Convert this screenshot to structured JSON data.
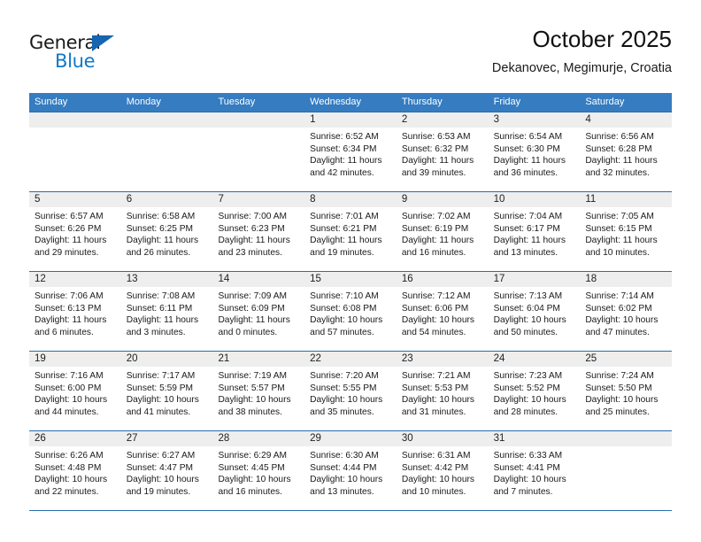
{
  "brand": {
    "name_top": "General",
    "name_bottom": "Blue",
    "triangle_color": "#1565b0",
    "blue_color": "#1279c6"
  },
  "header": {
    "title": "October 2025",
    "subtitle": "Dekanovec, Megimurje, Croatia"
  },
  "theme": {
    "header_bar": "#357cc1",
    "row_rule": "#2a6dae",
    "date_band": "#eeeeee"
  },
  "weekday_headers": [
    "Sunday",
    "Monday",
    "Tuesday",
    "Wednesday",
    "Thursday",
    "Friday",
    "Saturday"
  ],
  "weeks": [
    [
      {
        "day": "",
        "empty": true
      },
      {
        "day": "",
        "empty": true
      },
      {
        "day": "",
        "empty": true
      },
      {
        "day": "1",
        "sunrise": "Sunrise: 6:52 AM",
        "sunset": "Sunset: 6:34 PM",
        "daylight1": "Daylight: 11 hours",
        "daylight2": "and 42 minutes."
      },
      {
        "day": "2",
        "sunrise": "Sunrise: 6:53 AM",
        "sunset": "Sunset: 6:32 PM",
        "daylight1": "Daylight: 11 hours",
        "daylight2": "and 39 minutes."
      },
      {
        "day": "3",
        "sunrise": "Sunrise: 6:54 AM",
        "sunset": "Sunset: 6:30 PM",
        "daylight1": "Daylight: 11 hours",
        "daylight2": "and 36 minutes."
      },
      {
        "day": "4",
        "sunrise": "Sunrise: 6:56 AM",
        "sunset": "Sunset: 6:28 PM",
        "daylight1": "Daylight: 11 hours",
        "daylight2": "and 32 minutes."
      }
    ],
    [
      {
        "day": "5",
        "sunrise": "Sunrise: 6:57 AM",
        "sunset": "Sunset: 6:26 PM",
        "daylight1": "Daylight: 11 hours",
        "daylight2": "and 29 minutes."
      },
      {
        "day": "6",
        "sunrise": "Sunrise: 6:58 AM",
        "sunset": "Sunset: 6:25 PM",
        "daylight1": "Daylight: 11 hours",
        "daylight2": "and 26 minutes."
      },
      {
        "day": "7",
        "sunrise": "Sunrise: 7:00 AM",
        "sunset": "Sunset: 6:23 PM",
        "daylight1": "Daylight: 11 hours",
        "daylight2": "and 23 minutes."
      },
      {
        "day": "8",
        "sunrise": "Sunrise: 7:01 AM",
        "sunset": "Sunset: 6:21 PM",
        "daylight1": "Daylight: 11 hours",
        "daylight2": "and 19 minutes."
      },
      {
        "day": "9",
        "sunrise": "Sunrise: 7:02 AM",
        "sunset": "Sunset: 6:19 PM",
        "daylight1": "Daylight: 11 hours",
        "daylight2": "and 16 minutes."
      },
      {
        "day": "10",
        "sunrise": "Sunrise: 7:04 AM",
        "sunset": "Sunset: 6:17 PM",
        "daylight1": "Daylight: 11 hours",
        "daylight2": "and 13 minutes."
      },
      {
        "day": "11",
        "sunrise": "Sunrise: 7:05 AM",
        "sunset": "Sunset: 6:15 PM",
        "daylight1": "Daylight: 11 hours",
        "daylight2": "and 10 minutes."
      }
    ],
    [
      {
        "day": "12",
        "sunrise": "Sunrise: 7:06 AM",
        "sunset": "Sunset: 6:13 PM",
        "daylight1": "Daylight: 11 hours",
        "daylight2": "and 6 minutes."
      },
      {
        "day": "13",
        "sunrise": "Sunrise: 7:08 AM",
        "sunset": "Sunset: 6:11 PM",
        "daylight1": "Daylight: 11 hours",
        "daylight2": "and 3 minutes."
      },
      {
        "day": "14",
        "sunrise": "Sunrise: 7:09 AM",
        "sunset": "Sunset: 6:09 PM",
        "daylight1": "Daylight: 11 hours",
        "daylight2": "and 0 minutes."
      },
      {
        "day": "15",
        "sunrise": "Sunrise: 7:10 AM",
        "sunset": "Sunset: 6:08 PM",
        "daylight1": "Daylight: 10 hours",
        "daylight2": "and 57 minutes."
      },
      {
        "day": "16",
        "sunrise": "Sunrise: 7:12 AM",
        "sunset": "Sunset: 6:06 PM",
        "daylight1": "Daylight: 10 hours",
        "daylight2": "and 54 minutes."
      },
      {
        "day": "17",
        "sunrise": "Sunrise: 7:13 AM",
        "sunset": "Sunset: 6:04 PM",
        "daylight1": "Daylight: 10 hours",
        "daylight2": "and 50 minutes."
      },
      {
        "day": "18",
        "sunrise": "Sunrise: 7:14 AM",
        "sunset": "Sunset: 6:02 PM",
        "daylight1": "Daylight: 10 hours",
        "daylight2": "and 47 minutes."
      }
    ],
    [
      {
        "day": "19",
        "sunrise": "Sunrise: 7:16 AM",
        "sunset": "Sunset: 6:00 PM",
        "daylight1": "Daylight: 10 hours",
        "daylight2": "and 44 minutes."
      },
      {
        "day": "20",
        "sunrise": "Sunrise: 7:17 AM",
        "sunset": "Sunset: 5:59 PM",
        "daylight1": "Daylight: 10 hours",
        "daylight2": "and 41 minutes."
      },
      {
        "day": "21",
        "sunrise": "Sunrise: 7:19 AM",
        "sunset": "Sunset: 5:57 PM",
        "daylight1": "Daylight: 10 hours",
        "daylight2": "and 38 minutes."
      },
      {
        "day": "22",
        "sunrise": "Sunrise: 7:20 AM",
        "sunset": "Sunset: 5:55 PM",
        "daylight1": "Daylight: 10 hours",
        "daylight2": "and 35 minutes."
      },
      {
        "day": "23",
        "sunrise": "Sunrise: 7:21 AM",
        "sunset": "Sunset: 5:53 PM",
        "daylight1": "Daylight: 10 hours",
        "daylight2": "and 31 minutes."
      },
      {
        "day": "24",
        "sunrise": "Sunrise: 7:23 AM",
        "sunset": "Sunset: 5:52 PM",
        "daylight1": "Daylight: 10 hours",
        "daylight2": "and 28 minutes."
      },
      {
        "day": "25",
        "sunrise": "Sunrise: 7:24 AM",
        "sunset": "Sunset: 5:50 PM",
        "daylight1": "Daylight: 10 hours",
        "daylight2": "and 25 minutes."
      }
    ],
    [
      {
        "day": "26",
        "sunrise": "Sunrise: 6:26 AM",
        "sunset": "Sunset: 4:48 PM",
        "daylight1": "Daylight: 10 hours",
        "daylight2": "and 22 minutes."
      },
      {
        "day": "27",
        "sunrise": "Sunrise: 6:27 AM",
        "sunset": "Sunset: 4:47 PM",
        "daylight1": "Daylight: 10 hours",
        "daylight2": "and 19 minutes."
      },
      {
        "day": "28",
        "sunrise": "Sunrise: 6:29 AM",
        "sunset": "Sunset: 4:45 PM",
        "daylight1": "Daylight: 10 hours",
        "daylight2": "and 16 minutes."
      },
      {
        "day": "29",
        "sunrise": "Sunrise: 6:30 AM",
        "sunset": "Sunset: 4:44 PM",
        "daylight1": "Daylight: 10 hours",
        "daylight2": "and 13 minutes."
      },
      {
        "day": "30",
        "sunrise": "Sunrise: 6:31 AM",
        "sunset": "Sunset: 4:42 PM",
        "daylight1": "Daylight: 10 hours",
        "daylight2": "and 10 minutes."
      },
      {
        "day": "31",
        "sunrise": "Sunrise: 6:33 AM",
        "sunset": "Sunset: 4:41 PM",
        "daylight1": "Daylight: 10 hours",
        "daylight2": "and 7 minutes."
      },
      {
        "day": "",
        "empty": true
      }
    ]
  ]
}
